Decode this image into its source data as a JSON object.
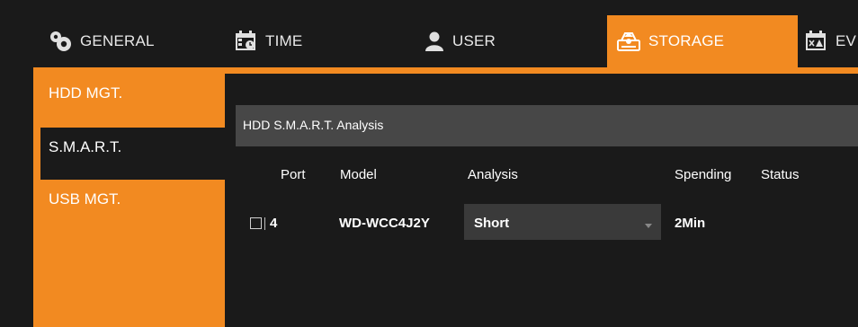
{
  "colors": {
    "accent": "#f28a21",
    "background": "#1a1a1a",
    "header_bar": "#474747"
  },
  "topnav": {
    "items": [
      {
        "label": "GENERAL",
        "icon": "gear-icon",
        "active": false
      },
      {
        "label": "TIME",
        "icon": "calendar-clock-icon",
        "active": false
      },
      {
        "label": "USER",
        "icon": "user-icon",
        "active": false
      },
      {
        "label": "STORAGE",
        "icon": "storage-icon",
        "active": true
      },
      {
        "label": "EV",
        "icon": "event-icon",
        "active": false
      }
    ]
  },
  "sidebar": {
    "items": [
      {
        "label": "HDD MGT.",
        "active": false
      },
      {
        "label": "S.M.A.R.T.",
        "active": true
      },
      {
        "label": "USB MGT.",
        "active": false
      }
    ]
  },
  "panel": {
    "title": "HDD S.M.A.R.T. Analysis",
    "columns": [
      "Port",
      "Model",
      "Analysis",
      "Spending",
      "Status"
    ],
    "rows": [
      {
        "checked": false,
        "port": "4",
        "model": "WD-WCC4J2Y",
        "analysis": "Short",
        "spending": "2Min",
        "status": ""
      }
    ]
  }
}
